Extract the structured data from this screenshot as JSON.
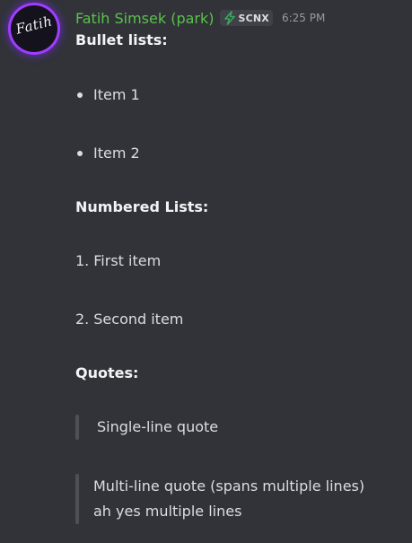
{
  "message": {
    "avatar_text": "Fatih",
    "username": "Fatih Simsek (park)",
    "tag": "SCNX",
    "timestamp": "6:25 PM",
    "colors": {
      "background": "#313338",
      "username": "#5ac24b",
      "text": "#dbdee1",
      "quote_bar": "#4e5058",
      "avatar_ring": "#a03cff"
    }
  },
  "content": {
    "bullet_heading": "Bullet lists:",
    "bullets": [
      "Item 1",
      "Item 2"
    ],
    "numbered_heading": "Numbered Lists:",
    "numbered": [
      {
        "num": "1.",
        "text": "First item"
      },
      {
        "num": "2.",
        "text": "Second item"
      }
    ],
    "quotes_heading": "Quotes:",
    "single_quote": "Single-line quote",
    "multi_quote": [
      "Multi-line quote (spans multiple lines)",
      "ah yes multiple lines"
    ]
  }
}
